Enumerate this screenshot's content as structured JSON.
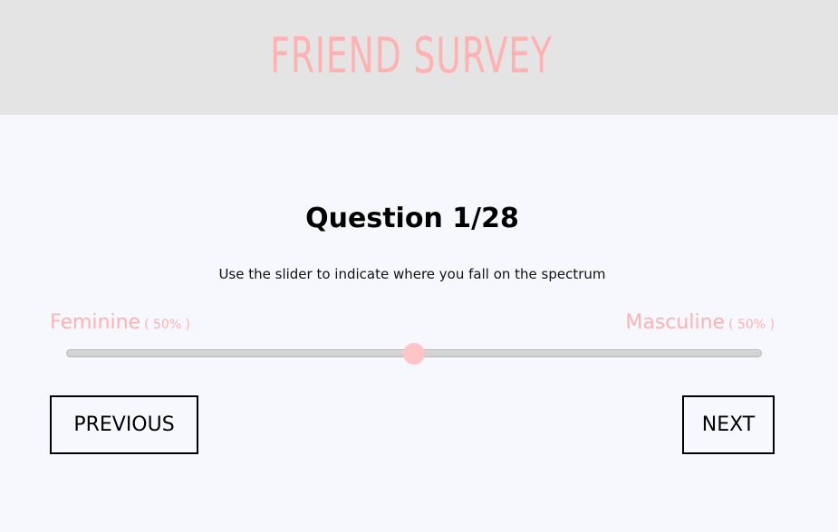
{
  "header": {
    "title": "FRIEND SURVEY"
  },
  "question": {
    "title": "Question 1/28",
    "instructions": "Use the slider to indicate where you fall on the spectrum"
  },
  "slider": {
    "left_label": "Feminine",
    "left_percent": "( 50% )",
    "right_label": "Masculine",
    "right_percent": "( 50% )",
    "value_percent": 50
  },
  "navigation": {
    "previous_label": "PREVIOUS",
    "next_label": "NEXT"
  },
  "colors": {
    "header_bg": "#e4e4e4",
    "page_bg": "#f7f8fd",
    "accent_pink": "#ffb2b2",
    "thumb_pink": "#ffc4c6"
  }
}
